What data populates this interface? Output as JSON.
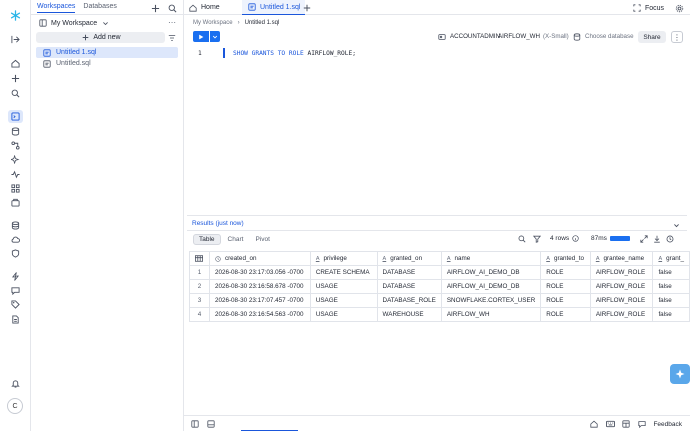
{
  "workspace_panel": {
    "tabs": [
      "Workspaces",
      "Databases"
    ],
    "workspace_name": "My Workspace",
    "add_new_label": "Add new",
    "files": [
      "Untitled 1.sql",
      "Untitled.sql"
    ]
  },
  "tabs": {
    "home_label": "Home",
    "active_tab_label": "Untitled 1.sql",
    "focus_label": "Focus"
  },
  "breadcrumb": {
    "parent": "My Workspace",
    "current": "Untitled 1.sql"
  },
  "context": {
    "role": "ACCOUNTADMIN",
    "warehouse": "AIRFLOW_WH",
    "warehouse_size": "(X-Small)",
    "database_placeholder": "Choose database",
    "share_label": "Share"
  },
  "editor": {
    "line_number": "1",
    "keyword_1": "SHOW GRANTS TO ROLE",
    "rest": " AIRFLOW_ROLE;"
  },
  "results": {
    "title": "Results (just now)",
    "views": [
      "Table",
      "Chart",
      "Pivot"
    ],
    "row_count": "4 rows",
    "duration": "87ms",
    "progress_fraction": 1.0,
    "columns": [
      "created_on",
      "privilege",
      "granted_on",
      "name",
      "granted_to",
      "grantee_name",
      "grant_"
    ],
    "rows": [
      [
        "1",
        "2026-08-30 23:17:03.056 -0700",
        "CREATE SCHEMA",
        "DATABASE",
        "AIRFLOW_AI_DEMO_DB",
        "ROLE",
        "AIRFLOW_ROLE",
        "false"
      ],
      [
        "2",
        "2026-08-30 23:16:58.678 -0700",
        "USAGE",
        "DATABASE",
        "AIRFLOW_AI_DEMO_DB",
        "ROLE",
        "AIRFLOW_ROLE",
        "false"
      ],
      [
        "3",
        "2026-08-30 23:17:07.457 -0700",
        "USAGE",
        "DATABASE_ROLE",
        "SNOWFLAKE.CORTEX_USER",
        "ROLE",
        "AIRFLOW_ROLE",
        "false"
      ],
      [
        "4",
        "2026-08-30 23:16:54.563 -0700",
        "USAGE",
        "WAREHOUSE",
        "AIRFLOW_WH",
        "ROLE",
        "AIRFLOW_ROLE",
        "false"
      ]
    ]
  },
  "bottom": {
    "feedback_label": "Feedback"
  },
  "user": {
    "avatar_initial": "C"
  },
  "colors": {
    "accent": "#1a56db",
    "run_button": "#1a6ff0",
    "brand": "#29b5e8"
  }
}
